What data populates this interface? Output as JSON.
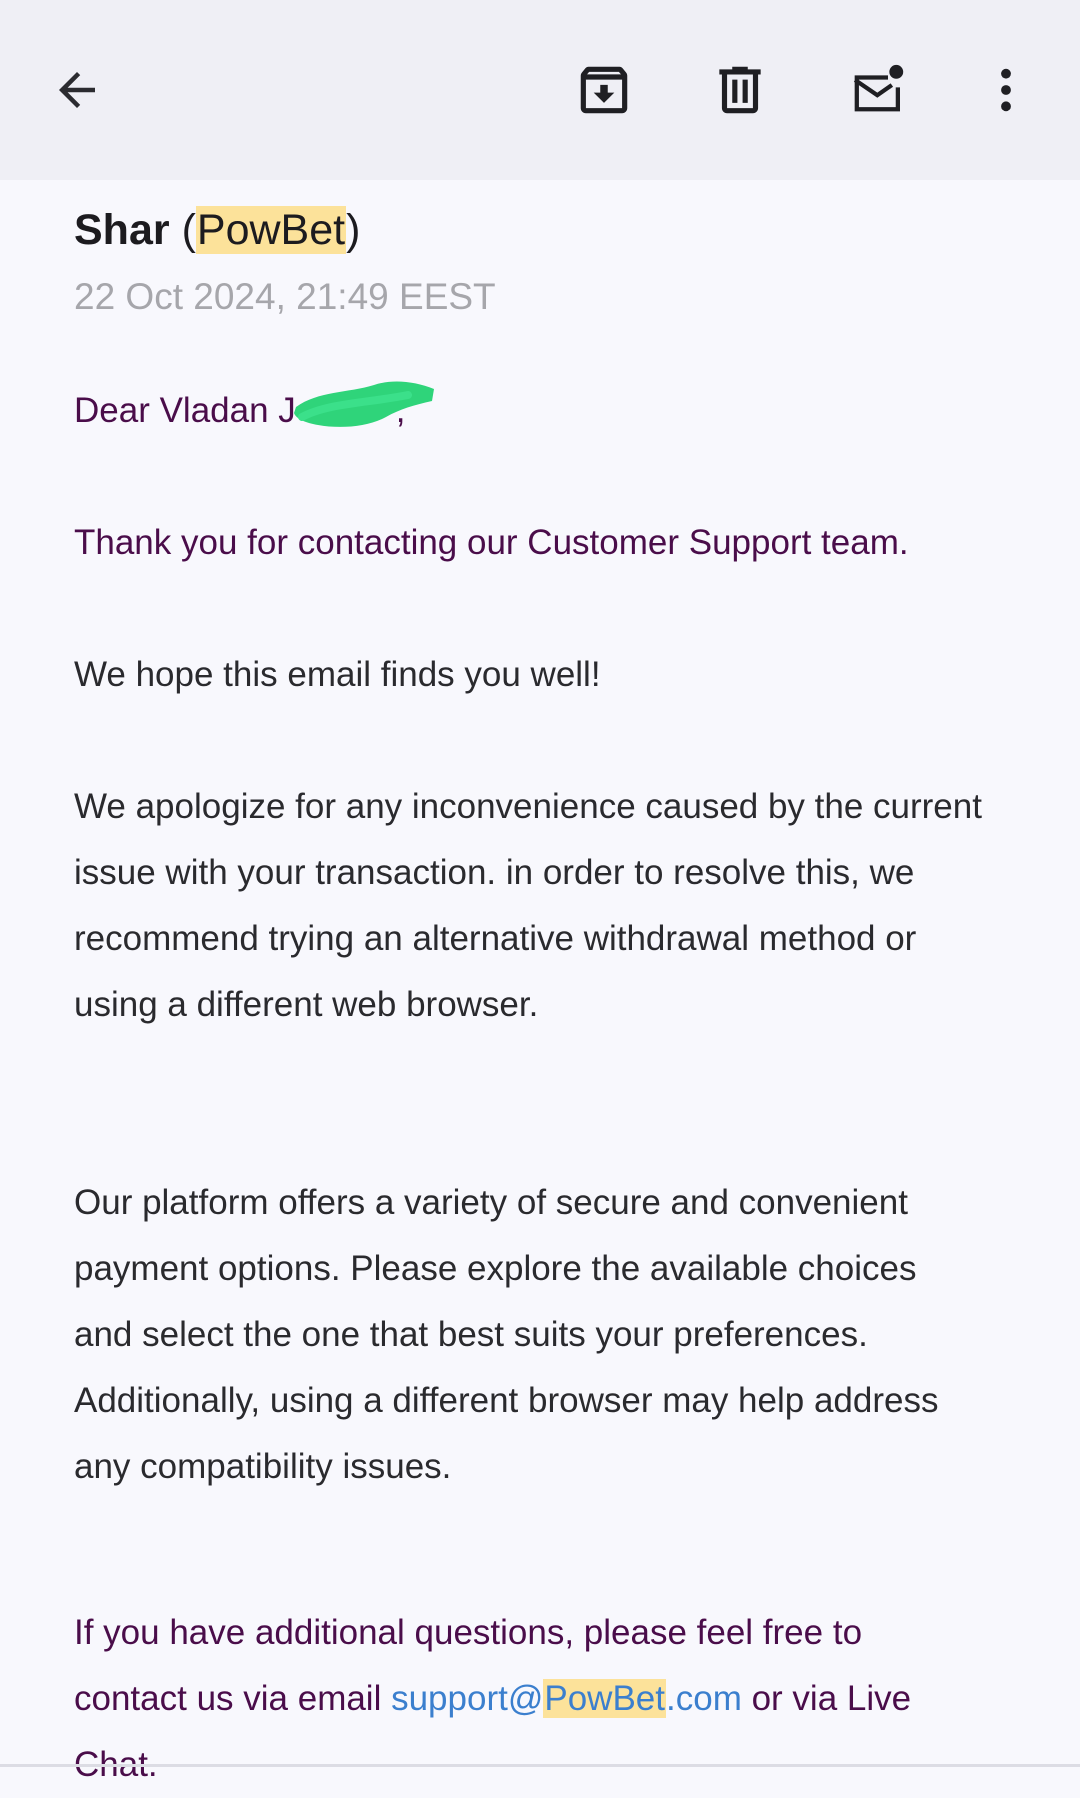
{
  "toolbar": {
    "back_icon": "arrow-left-icon",
    "archive_icon": "archive-icon",
    "delete_icon": "trash-icon",
    "mark_unread_icon": "mail-unread-icon",
    "more_icon": "more-vertical-icon"
  },
  "email": {
    "sender_name": "Shar",
    "sender_org": "PowBet",
    "timestamp": "22 Oct 2024, 21:49 EEST",
    "greeting": "Dear Vladan J",
    "greeting_end": ",",
    "p1": "Thank you for contacting our Customer Support team.",
    "p2": "We hope this email finds you well!",
    "p3_lines": [
      "We apologize for any inconvenience caused by the current",
      "issue with your transaction. in order to resolve this, we",
      "recommend trying an alternative withdrawal method or",
      "using a different web browser."
    ],
    "p4_lines": [
      "Our platform offers a variety of secure and convenient",
      "payment options. Please explore the available choices",
      "and select the one that best suits your preferences.",
      "Additionally, using a different browser may help address",
      "any compatibility issues."
    ],
    "p5_line1": "If you have additional questions, please feel free to",
    "p5_prefix": "contact us via email ",
    "email_user": "support@",
    "email_brand": "PowBet",
    "email_domain": ".com",
    "p5_suffix": " or via Live",
    "p5_line3": "Chat."
  },
  "colors": {
    "toolbar_bg": "#efeff5",
    "page_bg": "#f8f8fd",
    "highlight": "#fce29a",
    "purple_text": "#4a0d4a",
    "link": "#3b7fce",
    "redaction": "#2fd47a"
  }
}
